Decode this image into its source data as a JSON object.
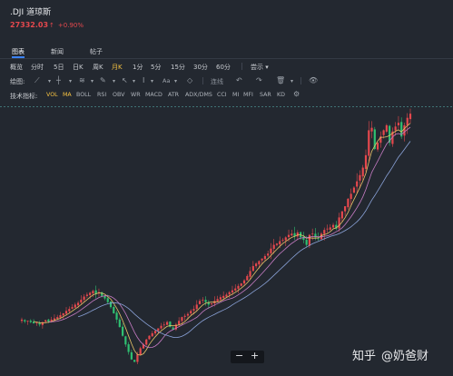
{
  "header": {
    "symbol": ".DJI",
    "name": "道琼斯",
    "price": "27332.03",
    "price_arrow": "↑",
    "change": "+0.90%"
  },
  "tabs": [
    {
      "label": "图表",
      "active": true
    },
    {
      "label": "新闻",
      "active": false
    },
    {
      "label": "帖子",
      "active": false
    }
  ],
  "period_bar": {
    "label": "概览",
    "items": [
      "分时",
      "5日",
      "日K",
      "周K",
      "月K",
      "1分",
      "5分",
      "15分",
      "30分",
      "60分"
    ],
    "active": "月K",
    "more": "尝示",
    "more_arrow": "▾"
  },
  "draw_bar": {
    "label": "绘图:",
    "text_tool": "Aa",
    "undo_label": "连线"
  },
  "indicator_bar": {
    "label": "技术指标:",
    "items": [
      "VOL",
      "MA",
      "BOLL",
      "RSI",
      "OBV",
      "WR",
      "MACD",
      "ATR",
      "ADX/DMS",
      "CCI",
      "MI",
      "MFI",
      "SAR",
      "KD"
    ],
    "active": [
      "VOL",
      "MA"
    ]
  },
  "zoom": {
    "minus": "−",
    "plus": "+"
  },
  "watermark": {
    "site": "知乎",
    "author": "@奶爸财"
  },
  "colors": {
    "up": "#e5484d",
    "down": "#2fbf71",
    "background": "#232830",
    "accent": "#f5c242",
    "ma_short": "#e8c468",
    "ma_mid": "#c77cc4",
    "ma_long": "#8aa2d8"
  },
  "chart_data": {
    "type": "candlestick",
    "description_source": "monthly K-line of .DJI",
    "closes": [
      10800,
      10650,
      10700,
      10600,
      10500,
      10550,
      10400,
      10600,
      10750,
      10650,
      10800,
      10900,
      11000,
      11150,
      11300,
      11500,
      11650,
      11800,
      12000,
      12150,
      12400,
      12650,
      12800,
      12950,
      13100,
      12850,
      13000,
      12700,
      12500,
      12200,
      11800,
      11300,
      10800,
      10200,
      9500,
      8800,
      8200,
      7600,
      7400,
      8000,
      8500,
      8800,
      9200,
      9500,
      9700,
      9900,
      10100,
      10300,
      10400,
      10600,
      10200,
      10000,
      10400,
      10700,
      11000,
      11100,
      11250,
      11500,
      11650,
      12000,
      12300,
      12400,
      12200,
      12000,
      12100,
      12300,
      12450,
      12600,
      12700,
      12800,
      13000,
      13150,
      13300,
      13500,
      13700,
      13950,
      14300,
      14700,
      15100,
      15300,
      15500,
      15700,
      15900,
      16100,
      16500,
      16800,
      16900,
      17100,
      17200,
      17400,
      17600,
      17700,
      17500,
      17800,
      17400,
      17200,
      16800,
      17600,
      17700,
      17400,
      17300,
      17700,
      18000,
      18100,
      18200,
      18400,
      18100,
      19000,
      19500,
      19900,
      20500,
      20900,
      21400,
      21900,
      22400,
      23000,
      24000,
      26000,
      26200,
      24500,
      25000,
      25500,
      26000,
      26400,
      25000,
      25900,
      26300,
      26600,
      25500,
      26400,
      27000,
      27332
    ]
  }
}
